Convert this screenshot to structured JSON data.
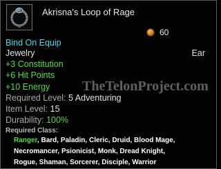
{
  "item": {
    "name": "Akrisna's Loop of Rage",
    "icon": "ring-icon",
    "price": "60",
    "price_icon": "copper-coin-icon",
    "binding": "Bind On Equip",
    "type": "Jewelry",
    "slot": "Ear",
    "stats": [
      "+3 Constitution",
      "+6 Hit Points",
      "+10 Energy"
    ],
    "required_level_label": "Required Level:",
    "required_level_value": "5 Adventuring",
    "item_level_label": "Item Level:",
    "item_level_value": "15",
    "durability_label": "Durability:",
    "durability_value": "100%",
    "required_class_label": "Required Class:",
    "classes": [
      "Ranger",
      "Bard",
      "Paladin",
      "Cleric",
      "Druid",
      "Blood Mage",
      "Necromancer",
      "Psionicist",
      "Monk",
      "Dread Knight",
      "Rogue",
      "Shaman",
      "Sorcerer",
      "Disciple",
      "Warrior"
    ],
    "highlighted_class": "Ranger"
  },
  "watermark": "TheTelonProject.com",
  "colors": {
    "cyan": "#4fd9ea",
    "green": "#5cd84c",
    "text": "#e2e2e2",
    "muted": "#a9a9a9",
    "border": "#5a5a5a"
  }
}
